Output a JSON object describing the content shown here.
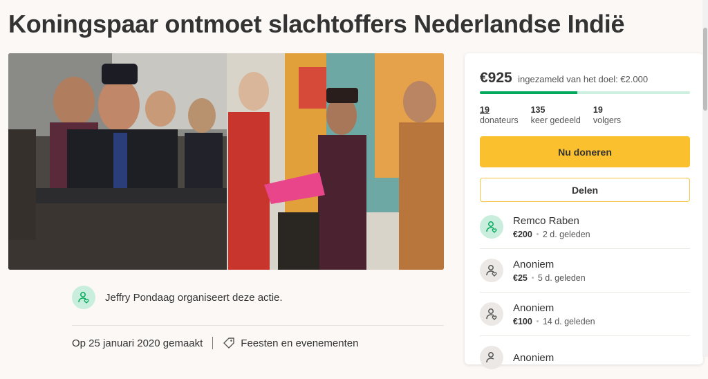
{
  "page": {
    "title": "Koningspaar ontmoet slachtoffers Nederlandse Indië"
  },
  "organizer": {
    "text": "Jeffry Pondaag organiseert deze actie.",
    "icon": "user-heart-icon"
  },
  "meta": {
    "created": "Op 25 januari 2020 gemaakt",
    "category": "Feesten en evenementen",
    "category_icon": "tag-icon"
  },
  "fundraiser": {
    "raised": "€925",
    "goal_text": "ingezameld van het doel: €2.000",
    "progress": 0.4625,
    "stats": [
      {
        "value": "19",
        "label": "donateurs"
      },
      {
        "value": "135",
        "label": "keer gedeeld"
      },
      {
        "value": "19",
        "label": "volgers"
      }
    ],
    "donate_label": "Nu doneren",
    "share_label": "Delen"
  },
  "donations": [
    {
      "name": "Remco Raben",
      "amount": "€200",
      "time": "2 d. geleden",
      "avatar": "green"
    },
    {
      "name": "Anoniem",
      "amount": "€25",
      "time": "5 d. geleden",
      "avatar": "grey"
    },
    {
      "name": "Anoniem",
      "amount": "€100",
      "time": "14 d. geleden",
      "avatar": "grey"
    },
    {
      "name": "Anoniem",
      "amount": "",
      "time": "",
      "avatar": "grey"
    }
  ],
  "colors": {
    "accent_green": "#02a95c",
    "donate_yellow": "#fbc02d",
    "background": "#fbf8f6"
  }
}
